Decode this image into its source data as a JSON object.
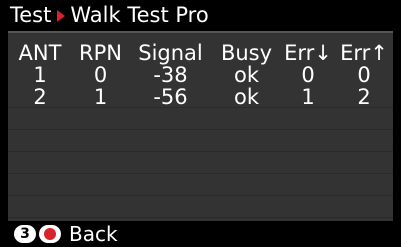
{
  "header": {
    "breadcrumb_parent": "Test",
    "breadcrumb_current": "Walk Test Pro"
  },
  "table": {
    "columns": [
      "ANT",
      "RPN",
      "Signal",
      "Busy",
      "Err↓",
      "Err↑"
    ],
    "rows": [
      [
        "1",
        "0",
        "-38",
        "ok",
        "0",
        "0"
      ],
      [
        "2",
        "1",
        "-56",
        "ok",
        "1",
        "2"
      ]
    ]
  },
  "footer": {
    "key_number": "3",
    "back_label": "Back"
  },
  "colors": {
    "accent": "#d8232a",
    "panel": "#333333",
    "bar": "#000000"
  },
  "icons": [
    "breadcrumb-arrow-icon",
    "record-icon"
  ]
}
